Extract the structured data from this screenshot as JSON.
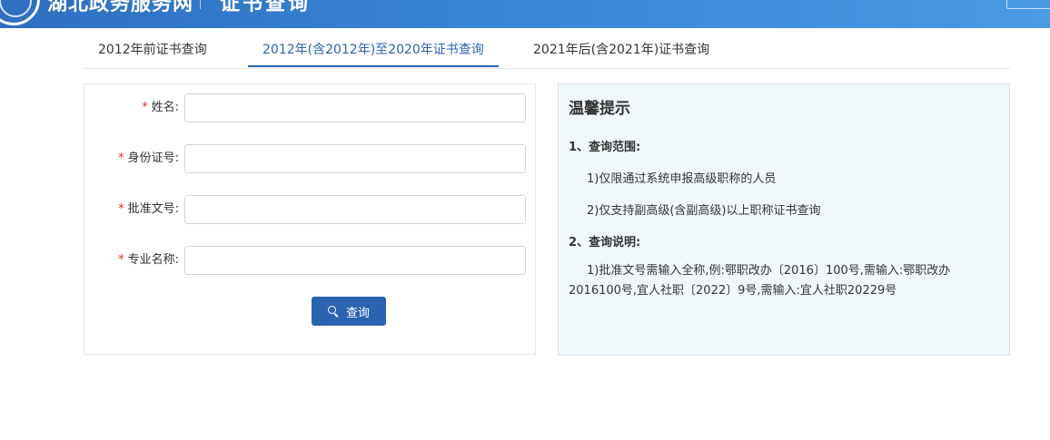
{
  "header": {
    "site_name": "湖北政务服务网",
    "subtitle": "证书查询"
  },
  "tabs": [
    {
      "label": "2012年前证书查询",
      "active": false
    },
    {
      "label": "2012年(含2012年)至2020年证书查询",
      "active": true
    },
    {
      "label": "2021年后(含2021年)证书查询",
      "active": false
    }
  ],
  "form": {
    "required_mark": "*",
    "fields": [
      {
        "label": "姓名:",
        "value": "",
        "placeholder": ""
      },
      {
        "label": "身份证号:",
        "value": "",
        "placeholder": ""
      },
      {
        "label": "批准文号:",
        "value": "",
        "placeholder": ""
      },
      {
        "label": "专业名称:",
        "value": "",
        "placeholder": ""
      }
    ],
    "search_button": "查询"
  },
  "tips": {
    "title": "温馨提示",
    "sections": [
      {
        "heading": "1、查询范围:",
        "items": [
          "1)仅限通过系统申报高级职称的人员",
          "2)仅支持副高级(含副高级)以上职称证书查询"
        ]
      },
      {
        "heading": "2、查询说明:",
        "paragraph": "1)批准文号需输入全称,例:鄂职改办〔2016〕100号,需输入:鄂职改办2016100号,宜人社职〔2022〕9号,需输入:宜人社职20229号"
      }
    ]
  },
  "colors": {
    "header_gradient_start": "#2d6fc0",
    "header_gradient_end": "#4a9ae4",
    "accent": "#2a63b0",
    "required": "#e02e24",
    "tips_background": "#f1f8fc"
  },
  "icons": {
    "logo": "emblem-icon",
    "search": "search-icon"
  }
}
